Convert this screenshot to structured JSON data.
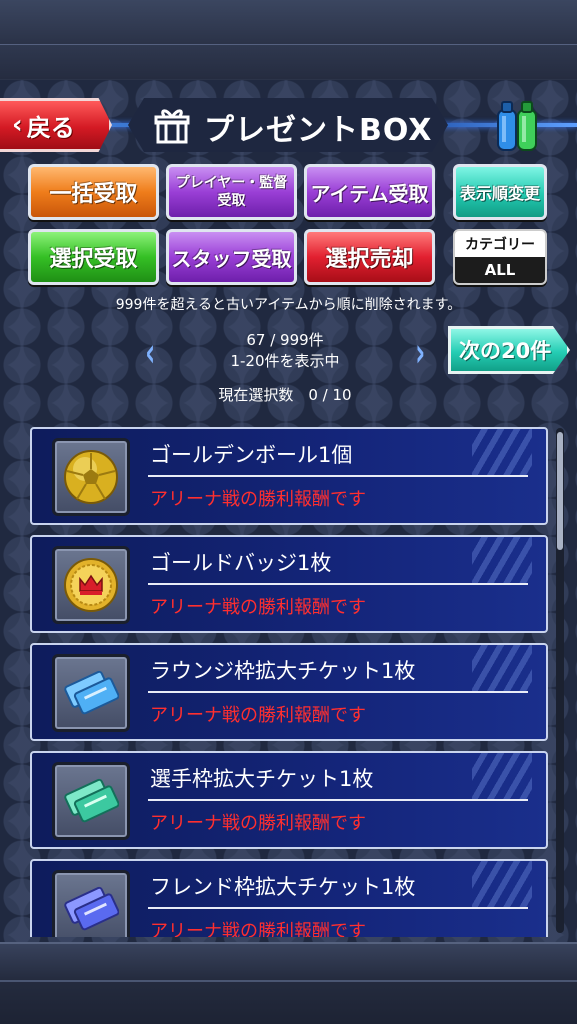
{
  "header": {
    "back_label": "戻る",
    "title": "プレゼントBOX"
  },
  "buttons": {
    "bulk_receive": "一括受取",
    "player_manager_receive_line1": "プレイヤー・監督",
    "player_manager_receive_line2": "受取",
    "item_receive": "アイテム受取",
    "sort_change": "表示順変更",
    "select_receive": "選択受取",
    "staff_receive": "スタッフ受取",
    "select_sell": "選択売却",
    "category_label": "カテゴリー",
    "category_value": "ALL"
  },
  "notice": "999件を超えると古いアイテムから順に削除されます。",
  "pagination": {
    "count": "67 / 999件",
    "range": "1-20件を表示中",
    "selected": "現在選択数　0 / 10",
    "next_label": "次の20件"
  },
  "items": [
    {
      "name": "ゴールデンボール1個",
      "desc": "アリーナ戦の勝利報酬です",
      "icon": "golden-ball-icon"
    },
    {
      "name": "ゴールドバッジ1枚",
      "desc": "アリーナ戦の勝利報酬です",
      "icon": "gold-badge-icon"
    },
    {
      "name": "ラウンジ枠拡大チケット1枚",
      "desc": "アリーナ戦の勝利報酬です",
      "icon": "ticket-blue-icon"
    },
    {
      "name": "選手枠拡大チケット1枚",
      "desc": "アリーナ戦の勝利報酬です",
      "icon": "ticket-green-icon"
    },
    {
      "name": "フレンド枠拡大チケット1枚",
      "desc": "アリーナ戦の勝利報酬です",
      "icon": "ticket-purple-icon"
    }
  ],
  "colors": {
    "accent_red": "#e22030",
    "accent_teal": "#23c9b0",
    "list_bg": "#14257a",
    "desc_red": "#ff2f2f"
  }
}
